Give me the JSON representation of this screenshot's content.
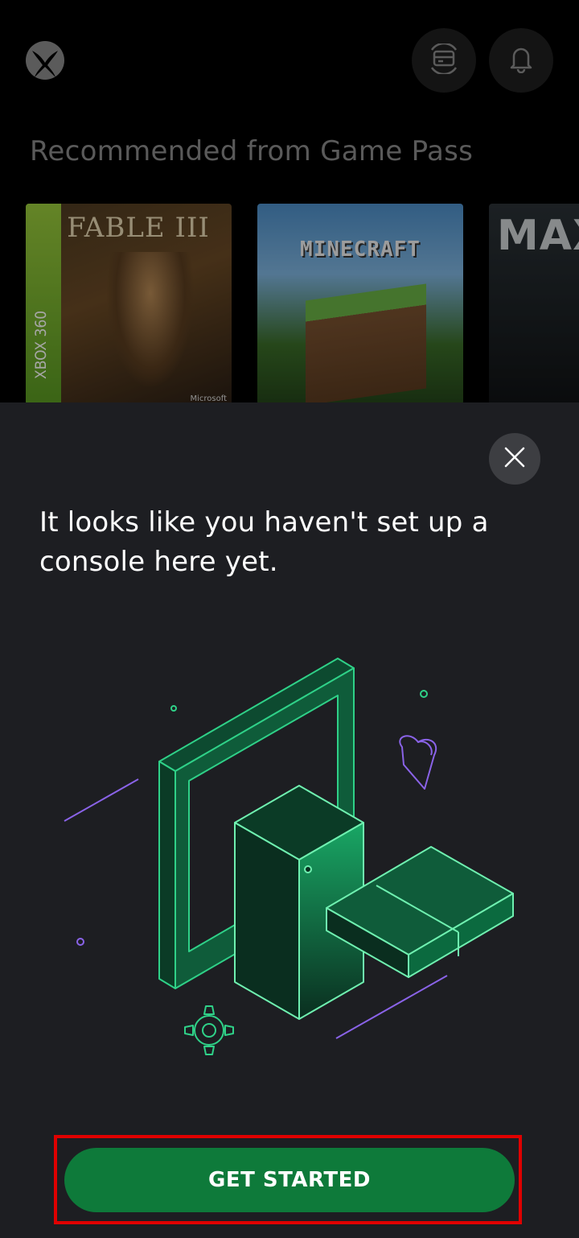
{
  "header": {
    "logo_icon": "xbox-logo-icon",
    "buttons": [
      {
        "icon": "game-pass-icon"
      },
      {
        "icon": "bell-icon"
      }
    ]
  },
  "recommended": {
    "title": "Recommended from Game Pass",
    "games": [
      {
        "title_art": "FABLE III",
        "platform": "XBOX 360",
        "publisher": "Microsoft"
      },
      {
        "title_art": "MINECRAFT"
      },
      {
        "title_art": "MAX"
      }
    ]
  },
  "sheet": {
    "close_icon": "close-icon",
    "message": "It looks like you haven't set up a console here yet.",
    "cta_label": "GET STARTED"
  },
  "colors": {
    "sheet_bg": "#1d1e22",
    "accent_green": "#0e7a3a",
    "illustration_green": "#2fd188",
    "illustration_purple": "#8a63e8",
    "highlight_red": "#e00000"
  }
}
